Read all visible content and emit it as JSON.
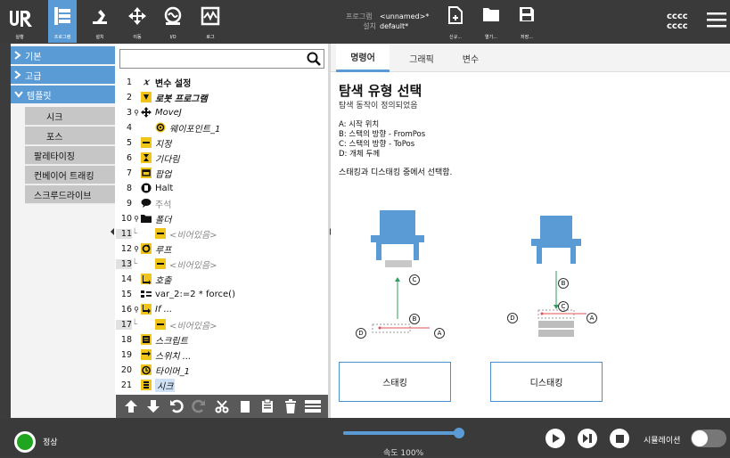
{
  "nav": [
    {
      "label": "실행"
    },
    {
      "label": "프로그램"
    },
    {
      "label": "설치"
    },
    {
      "label": "이동"
    },
    {
      "label": "I/O"
    },
    {
      "label": "로그"
    }
  ],
  "header": {
    "program_label": "프로그램",
    "program_value": "<unnamed>*",
    "install_label": "설치",
    "install_value": "default*",
    "file_new": "신규...",
    "file_open": "열기...",
    "file_save": "저장...",
    "user_line1": "cccc",
    "user_line2": "cccc"
  },
  "sidebar": {
    "basic": "기본",
    "advanced": "고급",
    "templates": "템플릿",
    "items": [
      "시크",
      "포스",
      "팔레타이징",
      "컨베이어 트래킹",
      "스크루드라이브"
    ]
  },
  "tree": {
    "rows": [
      {
        "num": "1",
        "text": "변수 설정",
        "icon": "x-variable-icon"
      },
      {
        "num": "2",
        "text": "로봇 프로그램",
        "icon": "flag-icon"
      },
      {
        "num": "3",
        "text": "MoveJ",
        "icon": "move-icon"
      },
      {
        "num": "4",
        "text": "웨이포인트_1",
        "icon": "waypoint-icon"
      },
      {
        "num": "5",
        "text": "지정",
        "icon": "set-icon"
      },
      {
        "num": "6",
        "text": "기다림",
        "icon": "hourglass-icon"
      },
      {
        "num": "7",
        "text": "팝업",
        "icon": "popup-icon"
      },
      {
        "num": "8",
        "text": "Halt",
        "icon": "halt-icon"
      },
      {
        "num": "9",
        "text": "주석",
        "icon": "comment-icon"
      },
      {
        "num": "10",
        "text": "폴더",
        "icon": "folder-icon"
      },
      {
        "num": "11",
        "text": "<비어있음>",
        "icon": "empty-icon"
      },
      {
        "num": "12",
        "text": "루프",
        "icon": "loop-icon"
      },
      {
        "num": "13",
        "text": "<비어있음>",
        "icon": "empty-icon"
      },
      {
        "num": "14",
        "text": "호출",
        "icon": "call-icon"
      },
      {
        "num": "15",
        "text": "var_2:=2 * force()",
        "icon": "assignment-icon"
      },
      {
        "num": "16",
        "text": "If ...",
        "icon": "if-icon"
      },
      {
        "num": "17",
        "text": "<비어있음>",
        "icon": "empty-icon"
      },
      {
        "num": "18",
        "text": "스크립트",
        "icon": "script-icon"
      },
      {
        "num": "19",
        "text": "스위치 ...",
        "icon": "switch-icon"
      },
      {
        "num": "20",
        "text": "타이머_1",
        "icon": "timer-icon"
      },
      {
        "num": "21",
        "text": "시크",
        "icon": "seek-icon"
      }
    ]
  },
  "tabs": [
    "명령어",
    "그래픽",
    "변수"
  ],
  "content": {
    "title": "탐색 유형 선택",
    "subtitle": "탐색 동작이 정의되었음",
    "legend": [
      "A: 시작 위치",
      "B: 스택의 방향 - FromPos",
      "C: 스택의 방향 - ToPos",
      "D: 개체 두께"
    ],
    "instruction": "스태킹과 디스태킹 중에서 선택함.",
    "stacking_label": "스태킹",
    "destacking_label": "디스태킹",
    "marker_a": "A",
    "marker_b": "B",
    "marker_c": "C",
    "marker_d": "D"
  },
  "status": {
    "state": "정상",
    "speed": "속도 100%",
    "speed_fraction": 1.0,
    "simulation": "시뮬레이션"
  },
  "colors": {
    "accent": "#5a9bd5",
    "topbar": "#3a3a3a",
    "status_ok": "#1fa51f"
  }
}
